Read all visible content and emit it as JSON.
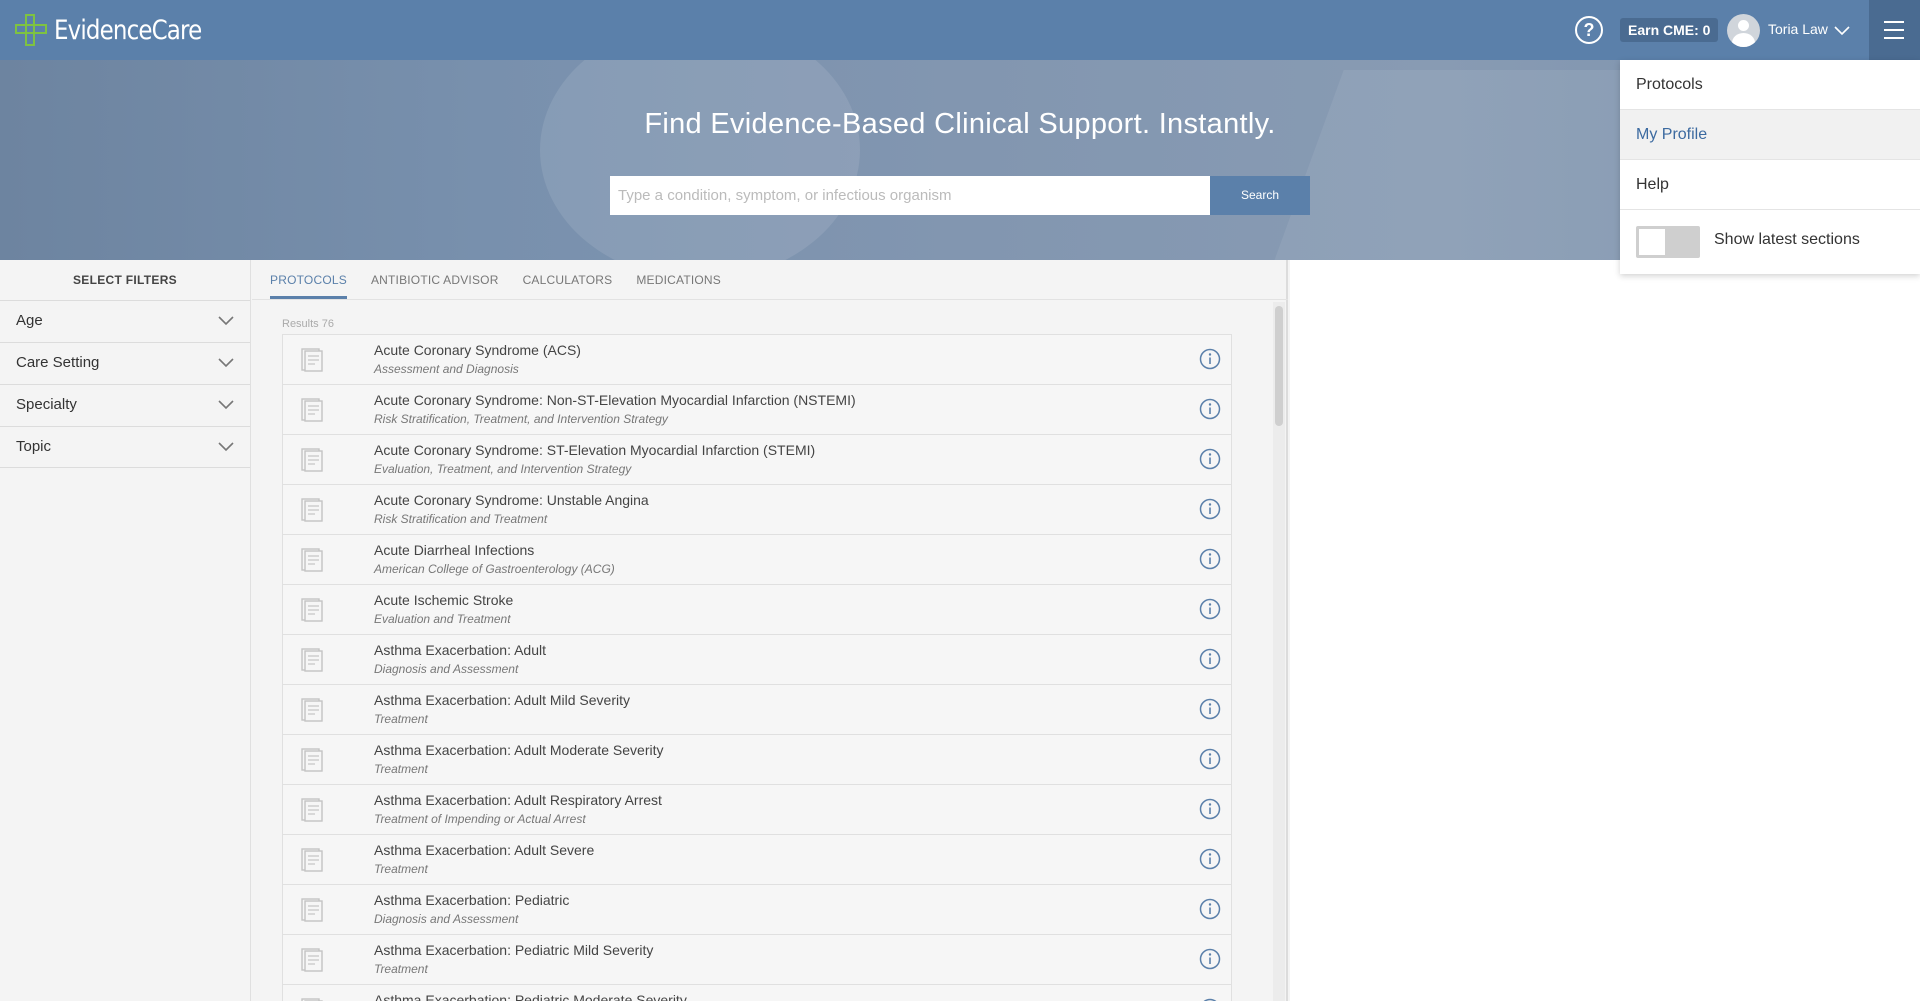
{
  "header": {
    "logo_text": "EvidenceCare",
    "help_symbol": "?",
    "cme_label": "Earn CME: 0",
    "user_name": "Toria Law",
    "brand_color": "#5b80aa",
    "logo_color": "#7ec242"
  },
  "hero": {
    "title": "Find Evidence-Based Clinical Support. Instantly.",
    "search_placeholder": "Type a condition, symptom, or infectious organism",
    "search_button": "Search"
  },
  "filters": {
    "title": "SELECT FILTERS",
    "items": [
      "Age",
      "Care Setting",
      "Specialty",
      "Topic"
    ]
  },
  "tabs": [
    "PROTOCOLS",
    "ANTIBIOTIC ADVISOR",
    "CALCULATORS",
    "MEDICATIONS"
  ],
  "active_tab": "PROTOCOLS",
  "results": {
    "count_label": "Results 76",
    "items": [
      {
        "title": "Acute Coronary Syndrome (ACS)",
        "subtitle": "Assessment and Diagnosis"
      },
      {
        "title": "Acute Coronary Syndrome: Non-ST-Elevation Myocardial Infarction (NSTEMI)",
        "subtitle": "Risk Stratification, Treatment, and Intervention Strategy"
      },
      {
        "title": "Acute Coronary Syndrome: ST-Elevation Myocardial Infarction (STEMI)",
        "subtitle": "Evaluation, Treatment, and Intervention Strategy"
      },
      {
        "title": "Acute Coronary Syndrome: Unstable Angina",
        "subtitle": "Risk Stratification and Treatment"
      },
      {
        "title": "Acute Diarrheal Infections",
        "subtitle": "American College of Gastroenterology (ACG)"
      },
      {
        "title": "Acute Ischemic Stroke",
        "subtitle": "Evaluation and Treatment"
      },
      {
        "title": "Asthma Exacerbation: Adult",
        "subtitle": "Diagnosis and Assessment"
      },
      {
        "title": "Asthma Exacerbation: Adult Mild Severity",
        "subtitle": "Treatment"
      },
      {
        "title": "Asthma Exacerbation: Adult Moderate Severity",
        "subtitle": "Treatment"
      },
      {
        "title": "Asthma Exacerbation: Adult Respiratory Arrest",
        "subtitle": "Treatment of Impending or Actual Arrest"
      },
      {
        "title": "Asthma Exacerbation: Adult Severe",
        "subtitle": "Treatment"
      },
      {
        "title": "Asthma Exacerbation: Pediatric",
        "subtitle": "Diagnosis and Assessment"
      },
      {
        "title": "Asthma Exacerbation: Pediatric Mild Severity",
        "subtitle": "Treatment"
      },
      {
        "title": "Asthma Exacerbation: Pediatric Moderate Severity",
        "subtitle": ""
      }
    ]
  },
  "menu": {
    "items": [
      "Protocols",
      "My Profile",
      "Help"
    ],
    "active_item": "My Profile",
    "toggle_label": "Show latest sections",
    "toggle_on": false
  },
  "icons": {
    "help": "help-circle-icon",
    "avatar": "user-avatar-icon",
    "user_menu": "chevron-down-icon",
    "menu": "hamburger-menu-icon",
    "filter": "chevron-down-icon",
    "result": "document-icon",
    "info": "info-icon"
  }
}
